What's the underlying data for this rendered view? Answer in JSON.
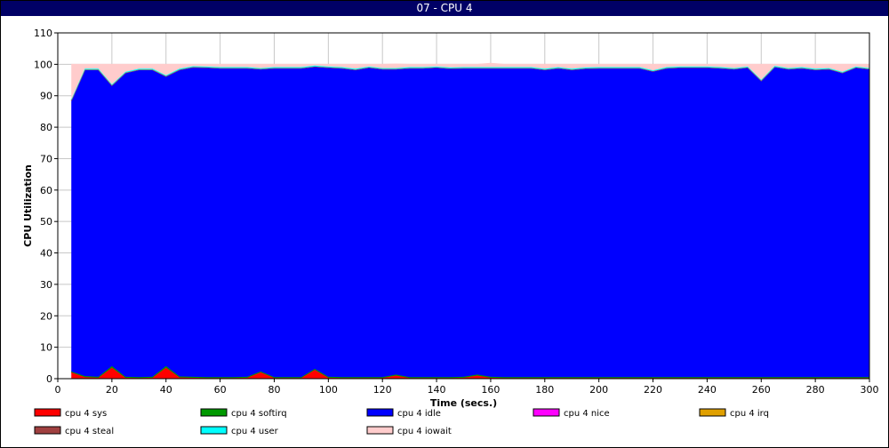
{
  "window": {
    "title": "07 - CPU 4"
  },
  "chart_data": {
    "type": "area",
    "stacked": true,
    "title": "07 - CPU 4",
    "xlabel": "Time (secs.)",
    "ylabel": "CPU Utilization",
    "xlim": [
      0,
      300
    ],
    "ylim": [
      0,
      110
    ],
    "xticks": [
      0,
      20,
      40,
      60,
      80,
      100,
      120,
      140,
      160,
      180,
      200,
      220,
      240,
      260,
      280,
      300
    ],
    "yticks": [
      0,
      10,
      20,
      30,
      40,
      50,
      60,
      70,
      80,
      90,
      100,
      110
    ],
    "grid": true,
    "legend_position": "bottom",
    "x": [
      5,
      10,
      15,
      20,
      25,
      30,
      35,
      40,
      45,
      50,
      55,
      60,
      65,
      70,
      75,
      80,
      85,
      90,
      95,
      100,
      105,
      110,
      115,
      120,
      125,
      130,
      135,
      140,
      145,
      150,
      155,
      160,
      165,
      170,
      175,
      180,
      185,
      190,
      195,
      200,
      205,
      210,
      215,
      220,
      225,
      230,
      235,
      240,
      245,
      250,
      255,
      260,
      265,
      270,
      275,
      280,
      285,
      290,
      295,
      300
    ],
    "series": [
      {
        "name": "cpu 4 sys",
        "color": "#ff0000",
        "values": [
          2.0,
          0.5,
          0.3,
          3.5,
          0.3,
          0.2,
          0.3,
          3.5,
          0.4,
          0.3,
          0.2,
          0.2,
          0.2,
          0.3,
          2.0,
          0.2,
          0.2,
          0.2,
          2.8,
          0.3,
          0.2,
          0.2,
          0.2,
          0.2,
          1.0,
          0.2,
          0.2,
          0.2,
          0.2,
          0.3,
          1.0,
          0.3,
          0.2,
          0.2,
          0.2,
          0.2,
          0.2,
          0.2,
          0.2,
          0.2,
          0.2,
          0.2,
          0.2,
          0.2,
          0.2,
          0.2,
          0.2,
          0.2,
          0.2,
          0.2,
          0.2,
          0.2,
          0.2,
          0.2,
          0.2,
          0.2,
          0.2,
          0.2,
          0.2,
          0.2
        ]
      },
      {
        "name": "cpu 4 softirq",
        "color": "#009900",
        "values": [
          0.3,
          0.3,
          0.3,
          0.5,
          0.3,
          0.3,
          0.3,
          0.5,
          0.3,
          0.3,
          0.3,
          0.3,
          0.3,
          0.3,
          0.3,
          0.3,
          0.3,
          0.3,
          0.3,
          0.3,
          0.3,
          0.3,
          0.3,
          0.3,
          0.3,
          0.3,
          0.3,
          0.3,
          0.3,
          0.3,
          0.3,
          0.3,
          0.3,
          0.3,
          0.3,
          0.3,
          0.3,
          0.3,
          0.3,
          0.3,
          0.3,
          0.3,
          0.3,
          0.3,
          0.3,
          0.3,
          0.3,
          0.3,
          0.3,
          0.3,
          0.3,
          0.3,
          0.3,
          0.3,
          0.3,
          0.3,
          0.3,
          0.3,
          0.3,
          0.3
        ]
      },
      {
        "name": "cpu 4 idle",
        "color": "#0000ff",
        "values": [
          86.2,
          97.5,
          97.7,
          89.3,
          96.7,
          97.8,
          97.7,
          92.2,
          97.6,
          98.5,
          98.5,
          98.3,
          98.3,
          98.2,
          96.2,
          98.3,
          98.3,
          98.3,
          96.2,
          98.4,
          98.3,
          97.8,
          98.5,
          98.0,
          97.2,
          98.3,
          98.3,
          98.5,
          98.2,
          98.2,
          97.5,
          98.2,
          98.3,
          98.3,
          98.3,
          97.8,
          98.3,
          97.8,
          98.2,
          98.3,
          98.3,
          98.3,
          98.3,
          97.3,
          98.3,
          98.5,
          98.5,
          98.5,
          98.3,
          98.0,
          98.5,
          94.3,
          98.7,
          98.0,
          98.3,
          97.8,
          98.0,
          96.8,
          98.5,
          98.0
        ]
      },
      {
        "name": "cpu 4 nice",
        "color": "#ff00ff",
        "values": [
          0,
          0,
          0,
          0,
          0,
          0,
          0,
          0,
          0,
          0,
          0,
          0,
          0,
          0,
          0,
          0,
          0,
          0,
          0,
          0,
          0,
          0,
          0,
          0,
          0,
          0,
          0,
          0,
          0,
          0,
          0,
          0,
          0,
          0,
          0,
          0,
          0,
          0,
          0,
          0,
          0,
          0,
          0,
          0,
          0,
          0,
          0,
          0,
          0,
          0,
          0,
          0,
          0,
          0,
          0,
          0,
          0,
          0,
          0,
          0
        ]
      },
      {
        "name": "cpu 4 irq",
        "color": "#e0a000",
        "values": [
          0,
          0,
          0,
          0,
          0,
          0,
          0,
          0,
          0,
          0,
          0,
          0,
          0,
          0,
          0,
          0,
          0,
          0,
          0,
          0,
          0,
          0,
          0,
          0,
          0,
          0,
          0,
          0,
          0,
          0,
          0,
          0,
          0,
          0,
          0,
          0,
          0,
          0,
          0,
          0,
          0,
          0,
          0,
          0,
          0,
          0,
          0,
          0,
          0,
          0,
          0,
          0,
          0,
          0,
          0,
          0,
          0,
          0,
          0,
          0
        ]
      },
      {
        "name": "cpu 4 steal",
        "color": "#a04040",
        "values": [
          0,
          0,
          0,
          0,
          0,
          0,
          0,
          0,
          0,
          0,
          0,
          0,
          0,
          0,
          0,
          0,
          0,
          0,
          0,
          0,
          0,
          0,
          0,
          0,
          0,
          0,
          0,
          0,
          0,
          0,
          0,
          0,
          0,
          0,
          0,
          0,
          0,
          0,
          0,
          0,
          0,
          0,
          0,
          0,
          0,
          0,
          0,
          0,
          0,
          0,
          0,
          0,
          0,
          0,
          0,
          0,
          0,
          0,
          0,
          0
        ]
      },
      {
        "name": "cpu 4 user",
        "color": "#00ffff",
        "values": [
          0.3,
          0.3,
          0.3,
          0.3,
          0.3,
          0.3,
          0.3,
          0.3,
          0.3,
          0.3,
          0.3,
          0.3,
          0.3,
          0.3,
          0.3,
          0.3,
          0.3,
          0.3,
          0.3,
          0.3,
          0.3,
          0.3,
          0.3,
          0.3,
          0.3,
          0.3,
          0.3,
          0.3,
          0.3,
          0.3,
          0.3,
          0.3,
          0.3,
          0.3,
          0.3,
          0.3,
          0.3,
          0.3,
          0.3,
          0.3,
          0.3,
          0.3,
          0.3,
          0.3,
          0.3,
          0.3,
          0.3,
          0.3,
          0.3,
          0.3,
          0.3,
          0.3,
          0.3,
          0.3,
          0.3,
          0.3,
          0.3,
          0.3,
          0.3,
          0.3
        ]
      },
      {
        "name": "cpu 4 iowait",
        "color": "#ffcccc",
        "values": [
          11.2,
          1.4,
          1.4,
          6.4,
          2.4,
          1.4,
          1.4,
          3.5,
          1.4,
          0.6,
          0.7,
          0.9,
          0.9,
          0.9,
          1.2,
          0.9,
          0.9,
          0.9,
          0.4,
          0.7,
          0.9,
          1.4,
          0.7,
          1.2,
          1.3,
          0.9,
          0.9,
          0.7,
          1.0,
          0.9,
          0.9,
          1.2,
          0.9,
          0.9,
          0.9,
          1.4,
          0.9,
          1.4,
          1.0,
          0.9,
          0.9,
          0.9,
          0.9,
          1.9,
          0.9,
          0.7,
          0.7,
          0.7,
          0.9,
          1.2,
          0.7,
          4.9,
          0.5,
          1.2,
          0.9,
          1.4,
          1.2,
          2.4,
          0.7,
          1.2
        ]
      }
    ]
  }
}
